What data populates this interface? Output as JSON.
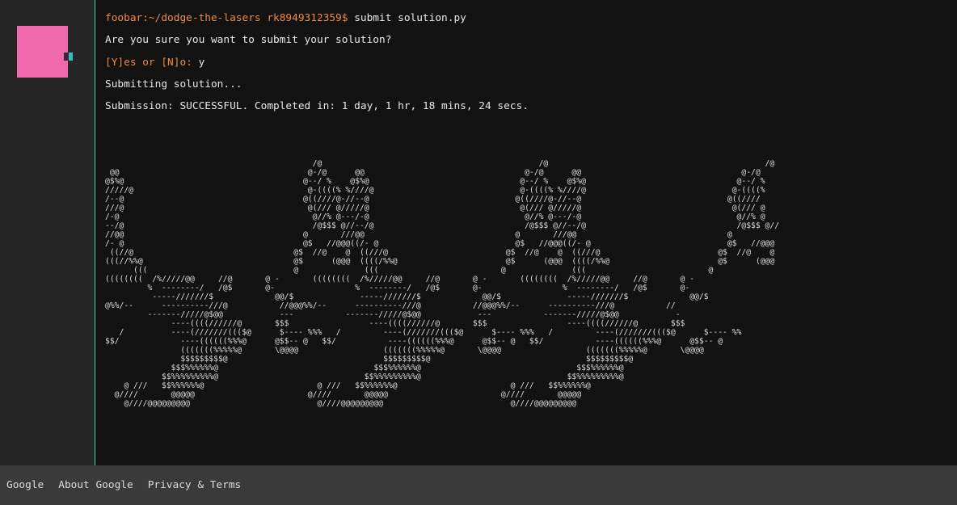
{
  "terminal": {
    "prompt": "foobar:~/dodge-the-lasers rk8949312359$",
    "command": " submit solution.py",
    "confirm_question": "Are you sure you want to submit your solution?",
    "confirm_prompt": "[Y]es or [N]o:",
    "confirm_answer": " y",
    "submitting": "Submitting solution...",
    "result": "Submission: SUCCESSFUL. Completed in: 1 day, 1 hr, 18 mins, 24 secs.",
    "ascii_art": "                                            /@                                              /@                                              /@\n @@                                        @-/@      @@                                  @-/@      @@                                  @-/@\n@$%@                                      @--/ %    @$%@                                @--/ %    @$%@                                @--/ %\n/////@                                     @-((((% %////@                               @-((((% %////@                               @-((((%\n/--@                                      @((////@-//--@                               @((////@-//--@                               @((////\n///@                                       @(/// @/////@                                @(/// @/////@                                @(/// @\n/-@                                         @//% @---/-@                                 @//% @---/-@                                 @//% @\n--/@                                        /@$$$ @//--/@                                /@$$$ @//--/@                                /@$$$ @//\n//@@                                      @       ///@@                                @       ///@@                                @\n/- @                                      @$   //@@@((/- @                             @$   //@@@((/- @                             @$   //@@@\n ((//@                                  @$  //@    @  ((///@                         @$  //@    @  ((///@                         @$  //@    @\n(((//%%@                                @$      (@@@  ((((/%%@                       @$      (@@@  ((((/%%@                       @$      (@@@\n      (((                               @              (((                          @              (((                          @\n((((((((  /%/////@@     //@       @ -       ((((((((  /%/////@@     //@       @ -       ((((((((  /%/////@@     //@       @ -\n         %  --------/   /@$       @-                 %  --------/   /@$       @-                 %  --------/   /@$       @-\n          -----///////$             @@/$              -----///////$             @@/$              -----///////$             @@/$\n@%%/--      ----------///@           //@@@%%/--      ----------///@           //@@@%%/--      ----------///@           //\n         -------/////@$@@            ---           -------/////@$@@            ---           -------/////@$@@            -\n              ----((((//////@       $$$                 ----((((//////@       $$$                 ----((((//////@       $$$\n   /          ----(///////((($@      $---- %%%   /         ----(///////((($@      $---- %%%   /         ----(///////((($@      $---- %%\n$$/             ----((((((%%%@      @$$-- @   $$/           ----((((((%%%@      @$$-- @   $$/           ----((((((%%%@      @$$-- @\n                (((((((%%%%%@       \\@@@@                  (((((((%%%%%@       \\@@@@                  (((((((%%%%%@       \\@@@@\n                $$$$$$$$$@                                 $$$$$$$$$@                                 $$$$$$$$$@\n              $$$%%%%%%@                                 $$$%%%%%%@                                 $$$%%%%%%@\n            $$%%%%%%%%%@                               $$%%%%%%%%%@                               $$%%%%%%%%%@\n    @ ///   $$%%%%%%@                        @ ///   $$%%%%%%@                        @ ///   $$%%%%%%@\n  @////       @@@@@                        @////       @@@@@                        @////       @@@@@\n    @////@@@@@@@@@                           @////@@@@@@@@@                           @////@@@@@@@@@"
  },
  "footer": {
    "links": [
      "Google",
      "About Google",
      "Privacy & Terms"
    ]
  },
  "colors": {
    "prompt": "#ef8b41",
    "accent": "#4fc2b2",
    "avatar": "#ee6aac"
  }
}
